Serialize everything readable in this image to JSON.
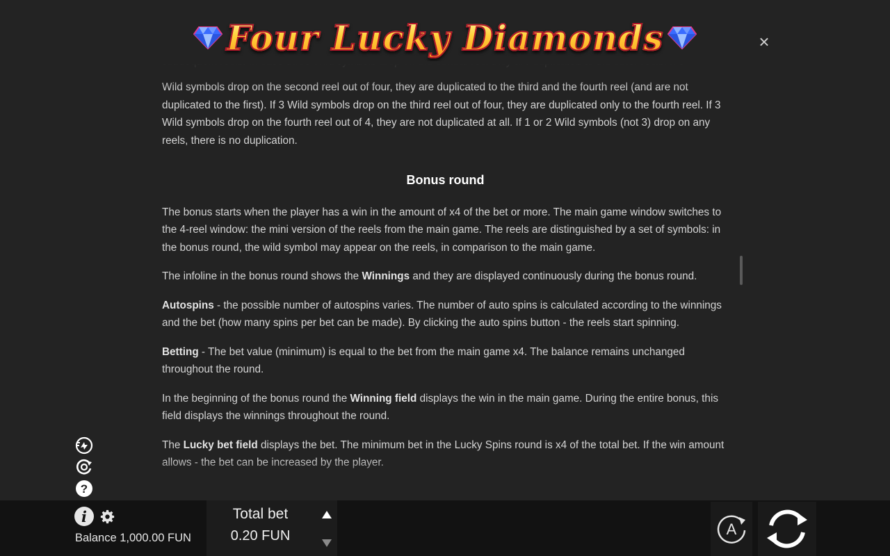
{
  "header": {
    "title": "Four Lucky Diamonds",
    "close_label": "×"
  },
  "content": {
    "para_intro_faded": "subsequent reels. In case three Wild symbols drop on the central reel they are duplicated to the other reels. If 3",
    "para_intro": "Wild symbols drop on the second reel out of four, they are duplicated to the third and the fourth reel (and are not duplicated to the first). If 3 Wild symbols drop on the third reel out of four, they are duplicated only to the fourth reel. If 3 Wild symbols drop on the fourth reel out of 4, they are not duplicated at all. If 1 or 2 Wild symbols (not 3) drop on any reels, there is no duplication.",
    "section_title": "Bonus round",
    "para_bonus": "The bonus starts when the player has a win in the amount of x4 of the bet or more. The main game window switches to the 4-reel window: the mini version of the reels from the main game. The reels are distinguished by a set of symbols: in the bonus round, the wild symbol may appear on the reels, in comparison to the main game.",
    "infoline_pre": "The infoline in the bonus round shows the ",
    "infoline_bold": "Winnings",
    "infoline_post": " and they are displayed continuously during the bonus round.",
    "autospins_bold": "Autospins",
    "autospins_text": " - the possible number of autospins varies. The number of auto spins is calculated according to the winnings and the bet (how many spins per bet can be made). By clicking the auto spins button - the reels start spinning.",
    "betting_bold": "Betting",
    "betting_text": " - The bet value (minimum) is equal to the bet from the main game x4. The balance remains unchanged throughout the round.",
    "winning_pre": "In the beginning of the bonus round the ",
    "winning_bold": "Winning field",
    "winning_post": " displays the win in the main game. During the entire bonus, this field displays the winnings throughout the round.",
    "lucky_pre": "The ",
    "lucky_bold": "Lucky bet field",
    "lucky_post": " displays the bet. The minimum bet in the Lucky Spins round is x4 of the total bet. If the win amount allows - the bet can be increased by the player."
  },
  "footer": {
    "balance": "Balance 1,000.00 FUN",
    "total_bet_label": "Total bet",
    "total_bet_value": "0.20 FUN",
    "auto_label": "A"
  },
  "icons": {
    "side": [
      "turbo-icon",
      "autoplay-icon",
      "help-icon"
    ],
    "bottom": [
      "info-icon",
      "gear-icon",
      "bet-up-icon",
      "bet-down-icon",
      "auto-icon",
      "spin-icon"
    ]
  },
  "colors": {
    "background": "#232323",
    "bottombar": "#121212",
    "text": "#d4d4d4",
    "title_gold": "#ffd23a",
    "title_outline": "#b0162a"
  }
}
